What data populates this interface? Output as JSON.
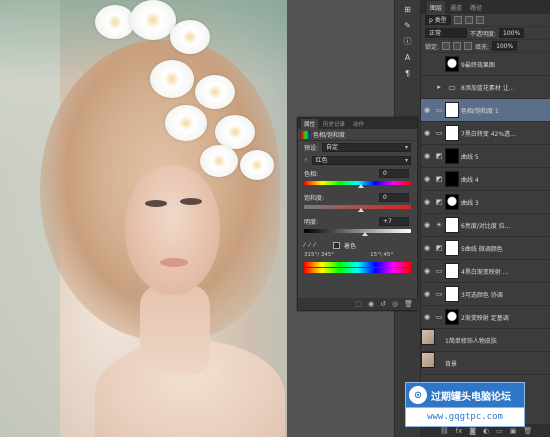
{
  "layers_panel": {
    "tabs": [
      "图层",
      "通道",
      "路径"
    ],
    "kind_label": "p 类型",
    "blend_mode": "正常",
    "opacity_label": "不透明度:",
    "opacity_value": "100%",
    "lock_label": "锁定:",
    "fill_label": "填充:",
    "fill_value": "100%",
    "layers": [
      {
        "name": "9最终效果图",
        "thumb": "mixed",
        "visible": false,
        "kind": "",
        "selected": false
      },
      {
        "name": "8添加蓝花素材 让...",
        "thumb": "folder",
        "visible": false,
        "kind": "▸",
        "selected": false
      },
      {
        "name": "色相/饱和度 1",
        "thumb": "white",
        "visible": true,
        "kind": "▭",
        "selected": true
      },
      {
        "name": "7黑白转变 42%透...",
        "thumb": "white",
        "visible": true,
        "kind": "▭",
        "selected": false
      },
      {
        "name": "曲线 5",
        "thumb": "black",
        "visible": true,
        "kind": "◩",
        "selected": false
      },
      {
        "name": "曲线 4",
        "thumb": "black",
        "visible": true,
        "kind": "◩",
        "selected": false
      },
      {
        "name": "曲线 3",
        "thumb": "mixed",
        "visible": true,
        "kind": "◩",
        "selected": false
      },
      {
        "name": "6亮度/对比度 拉...",
        "thumb": "white",
        "visible": true,
        "kind": "☀",
        "selected": false
      },
      {
        "name": "5曲线 微调颜色",
        "thumb": "white",
        "visible": true,
        "kind": "◩",
        "selected": false
      },
      {
        "name": "4黑白渐变映射 ...",
        "thumb": "white",
        "visible": true,
        "kind": "▭",
        "selected": false
      },
      {
        "name": "3可选颜色 协调",
        "thumb": "white",
        "visible": true,
        "kind": "▭",
        "selected": false
      },
      {
        "name": "2渐变映射 定基调",
        "thumb": "mixed",
        "visible": true,
        "kind": "▭",
        "selected": false
      },
      {
        "name": "1简单修饰人物皮肤",
        "thumb": "photo",
        "visible": true,
        "kind": "",
        "selected": false
      },
      {
        "name": "背景",
        "thumb": "photo",
        "visible": true,
        "kind": "",
        "selected": false
      }
    ]
  },
  "properties_panel": {
    "tabs": [
      "属性",
      "历史记录",
      "动作"
    ],
    "title": "色相/饱和度",
    "preset_label": "预设:",
    "preset_value": "自定",
    "channel_value": "红色",
    "hue_label": "色相:",
    "hue_value": "0",
    "sat_label": "饱和度:",
    "sat_value": "0",
    "light_label": "明度:",
    "light_value": "+7",
    "colorize_label": "着色",
    "range_left": "315°/ 345°",
    "range_right": "15°\\ 45°"
  },
  "watermark": {
    "title": "过期罐头电脑论坛",
    "url": "www.gqgtpc.com"
  }
}
